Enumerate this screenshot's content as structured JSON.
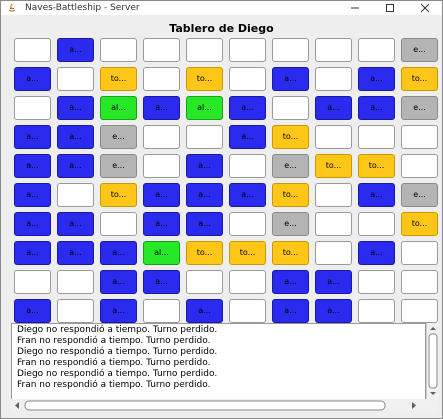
{
  "window": {
    "title": "Naves-Battleship - Server",
    "accent": "#2b2bf0"
  },
  "board": {
    "title": "Tablero de Diego",
    "legend_colors": {
      "empty": "#ffffff",
      "ship": "#2b2bf0",
      "tocado": "#ffc61a",
      "agua": "#b4b4b4",
      "alcanzado": "#27e827"
    },
    "rows": [
      [
        {
          "t": "empty",
          "l": ""
        },
        {
          "t": "ship",
          "l": "a..."
        },
        {
          "t": "empty",
          "l": ""
        },
        {
          "t": "empty",
          "l": ""
        },
        {
          "t": "empty",
          "l": ""
        },
        {
          "t": "empty",
          "l": ""
        },
        {
          "t": "empty",
          "l": ""
        },
        {
          "t": "empty",
          "l": ""
        },
        {
          "t": "empty",
          "l": ""
        },
        {
          "t": "water",
          "l": "e..."
        }
      ],
      [
        {
          "t": "ship",
          "l": "a..."
        },
        {
          "t": "empty",
          "l": ""
        },
        {
          "t": "tocado",
          "l": "to..."
        },
        {
          "t": "empty",
          "l": ""
        },
        {
          "t": "tocado",
          "l": "to..."
        },
        {
          "t": "empty",
          "l": ""
        },
        {
          "t": "ship",
          "l": "a..."
        },
        {
          "t": "empty",
          "l": ""
        },
        {
          "t": "ship",
          "l": "a..."
        },
        {
          "t": "tocado",
          "l": "to..."
        }
      ],
      [
        {
          "t": "empty",
          "l": ""
        },
        {
          "t": "ship",
          "l": "a..."
        },
        {
          "t": "hit",
          "l": "al..."
        },
        {
          "t": "ship",
          "l": "a..."
        },
        {
          "t": "hit",
          "l": "al..."
        },
        {
          "t": "ship",
          "l": "a..."
        },
        {
          "t": "empty",
          "l": ""
        },
        {
          "t": "ship",
          "l": "a..."
        },
        {
          "t": "ship",
          "l": "a..."
        },
        {
          "t": "water",
          "l": "e..."
        }
      ],
      [
        {
          "t": "ship",
          "l": "a..."
        },
        {
          "t": "ship",
          "l": "a..."
        },
        {
          "t": "water",
          "l": "e..."
        },
        {
          "t": "empty",
          "l": ""
        },
        {
          "t": "empty",
          "l": ""
        },
        {
          "t": "ship",
          "l": "a..."
        },
        {
          "t": "tocado",
          "l": "to..."
        },
        {
          "t": "empty",
          "l": ""
        },
        {
          "t": "empty",
          "l": ""
        },
        {
          "t": "empty",
          "l": ""
        }
      ],
      [
        {
          "t": "ship",
          "l": "a..."
        },
        {
          "t": "ship",
          "l": "a..."
        },
        {
          "t": "water",
          "l": "e..."
        },
        {
          "t": "empty",
          "l": ""
        },
        {
          "t": "ship",
          "l": "a..."
        },
        {
          "t": "empty",
          "l": ""
        },
        {
          "t": "water",
          "l": "e..."
        },
        {
          "t": "tocado",
          "l": "to..."
        },
        {
          "t": "tocado",
          "l": "to..."
        },
        {
          "t": "empty",
          "l": ""
        }
      ],
      [
        {
          "t": "ship",
          "l": "a..."
        },
        {
          "t": "empty",
          "l": ""
        },
        {
          "t": "tocado",
          "l": "to..."
        },
        {
          "t": "ship",
          "l": "a..."
        },
        {
          "t": "ship",
          "l": "a..."
        },
        {
          "t": "ship",
          "l": "a..."
        },
        {
          "t": "tocado",
          "l": "to..."
        },
        {
          "t": "empty",
          "l": ""
        },
        {
          "t": "ship",
          "l": "a..."
        },
        {
          "t": "water",
          "l": "e..."
        }
      ],
      [
        {
          "t": "ship",
          "l": "a..."
        },
        {
          "t": "ship",
          "l": "a..."
        },
        {
          "t": "empty",
          "l": ""
        },
        {
          "t": "ship",
          "l": "a..."
        },
        {
          "t": "ship",
          "l": "a..."
        },
        {
          "t": "empty",
          "l": ""
        },
        {
          "t": "water",
          "l": "e..."
        },
        {
          "t": "empty",
          "l": ""
        },
        {
          "t": "empty",
          "l": ""
        },
        {
          "t": "tocado",
          "l": "to..."
        }
      ],
      [
        {
          "t": "ship",
          "l": "a..."
        },
        {
          "t": "ship",
          "l": "a..."
        },
        {
          "t": "ship",
          "l": "a..."
        },
        {
          "t": "hit",
          "l": "al..."
        },
        {
          "t": "tocado",
          "l": "to..."
        },
        {
          "t": "tocado",
          "l": "to..."
        },
        {
          "t": "tocado",
          "l": "to..."
        },
        {
          "t": "empty",
          "l": ""
        },
        {
          "t": "ship",
          "l": "a..."
        },
        {
          "t": "empty",
          "l": ""
        }
      ],
      [
        {
          "t": "empty",
          "l": ""
        },
        {
          "t": "empty",
          "l": ""
        },
        {
          "t": "ship",
          "l": "a..."
        },
        {
          "t": "ship",
          "l": "a..."
        },
        {
          "t": "empty",
          "l": ""
        },
        {
          "t": "empty",
          "l": ""
        },
        {
          "t": "ship",
          "l": "a..."
        },
        {
          "t": "ship",
          "l": "a..."
        },
        {
          "t": "empty",
          "l": ""
        },
        {
          "t": "empty",
          "l": ""
        }
      ],
      [
        {
          "t": "ship",
          "l": "a..."
        },
        {
          "t": "empty",
          "l": ""
        },
        {
          "t": "ship",
          "l": "a..."
        },
        {
          "t": "empty",
          "l": ""
        },
        {
          "t": "ship",
          "l": "a..."
        },
        {
          "t": "empty",
          "l": ""
        },
        {
          "t": "ship",
          "l": "a..."
        },
        {
          "t": "ship",
          "l": "a..."
        },
        {
          "t": "empty",
          "l": ""
        },
        {
          "t": "empty",
          "l": ""
        }
      ]
    ]
  },
  "log": {
    "lines": [
      "Diego no respondió a tiempo. Turno perdido.",
      "Fran no respondió a tiempo. Turno perdido.",
      "Diego no respondió a tiempo. Turno perdido.",
      "Fran no respondió a tiempo. Turno perdido.",
      "Diego no respondió a tiempo. Turno perdido.",
      "Fran no respondió a tiempo. Turno perdido."
    ]
  },
  "icons": {
    "app": "java-app-icon",
    "minimize": "minimize-icon",
    "maximize": "maximize-icon",
    "close": "close-icon"
  }
}
